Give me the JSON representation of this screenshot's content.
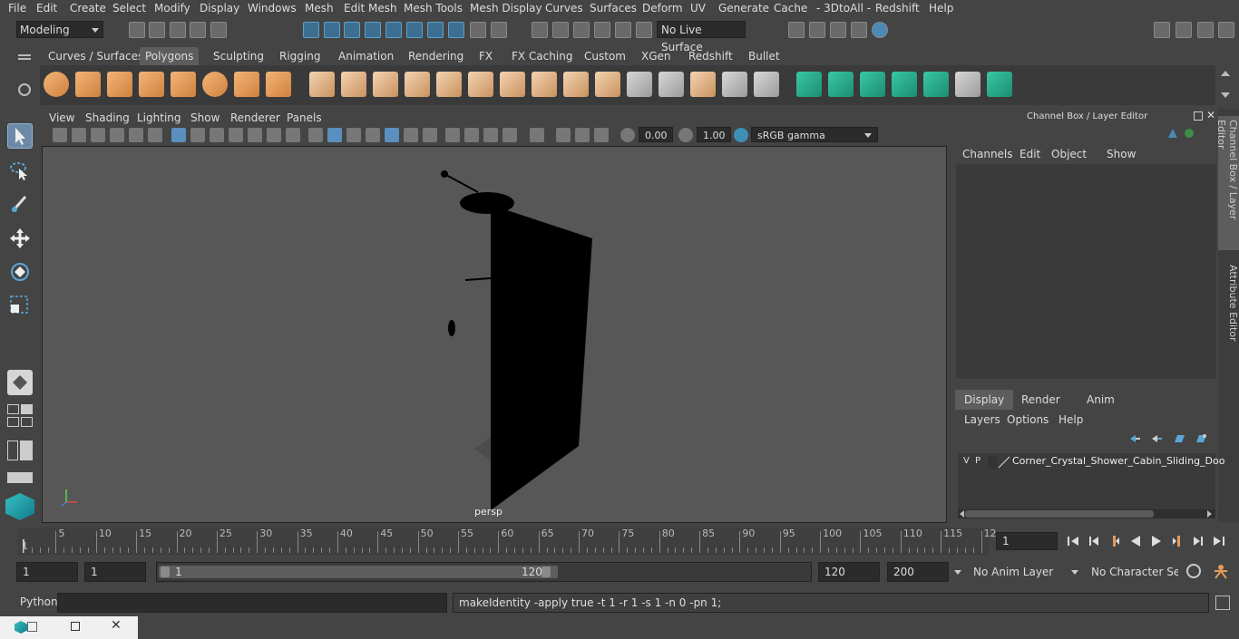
{
  "menubar": {
    "items": [
      "File",
      "Edit",
      "Create",
      "Select",
      "Modify",
      "Display",
      "Windows",
      "Mesh",
      "Edit Mesh",
      "Mesh Tools",
      "Mesh Display",
      "Curves",
      "Surfaces",
      "Deform",
      "UV",
      "Generate",
      "Cache",
      "- 3DtoAll -",
      "Redshift",
      "Help"
    ]
  },
  "statusline": {
    "mode": "Modeling",
    "live_surface": "No Live Surface"
  },
  "shelf": {
    "tabs": [
      "Curves / Surfaces",
      "Polygons",
      "Sculpting",
      "Rigging",
      "Animation",
      "Rendering",
      "FX",
      "FX Caching",
      "Custom",
      "XGen",
      "Redshift",
      "Bullet"
    ],
    "active_tab": "Polygons"
  },
  "viewport": {
    "menu": [
      "View",
      "Shading",
      "Lighting",
      "Show",
      "Renderer",
      "Panels"
    ],
    "exposure": "0.00",
    "gamma": "1.00",
    "color_space": "sRGB gamma",
    "camera_label": "persp"
  },
  "channelbox": {
    "title": "Channel Box / Layer Editor",
    "menu": [
      "Channels",
      "Edit",
      "Object",
      "Show"
    ],
    "side_tabs": [
      "Channel Box / Layer Editor",
      "Attribute Editor"
    ]
  },
  "layers": {
    "tabs": [
      "Display",
      "Render",
      "Anim"
    ],
    "active_tab": "Display",
    "menu": [
      "Layers",
      "Options",
      "Help"
    ],
    "rows": [
      {
        "v": "V",
        "p": "P",
        "name": "Corner_Crystal_Shower_Cabin_Sliding_Doo"
      }
    ]
  },
  "timeslider": {
    "labels": [
      "5",
      "10",
      "15",
      "20",
      "25",
      "30",
      "35",
      "40",
      "45",
      "50",
      "55",
      "60",
      "65",
      "70",
      "75",
      "80",
      "85",
      "90",
      "95",
      "100",
      "105",
      "110",
      "115",
      "12"
    ],
    "start_label": "1",
    "current_frame": "1"
  },
  "range": {
    "start": "1",
    "playback_start": "1",
    "slider_start": "1",
    "slider_end": "120",
    "playback_end": "120",
    "end": "200",
    "anim_layer": "No Anim Layer",
    "character_set": "No Character Set"
  },
  "commandline": {
    "language": "Python",
    "input": "",
    "result": "makeIdentity -apply true -t 1 -r 1 -s 1 -n 0 -pn 1;"
  },
  "colors": {
    "bg": "#444444",
    "viewport": "#575757",
    "accent": "#5a8fbf",
    "shelf_orange": "#e39b5a",
    "shelf_teal": "#2aa888"
  }
}
